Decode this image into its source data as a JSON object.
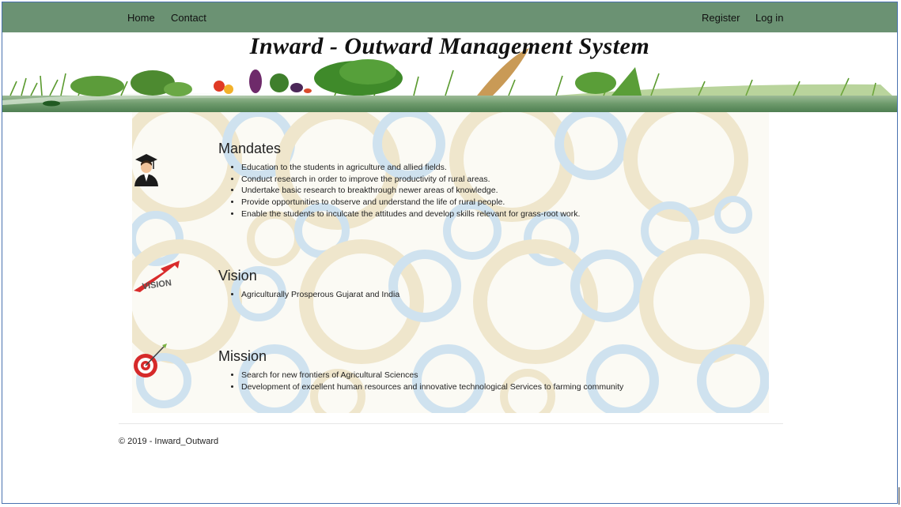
{
  "nav": {
    "home": "Home",
    "contact": "Contact",
    "register": "Register",
    "login": "Log in"
  },
  "banner": {
    "title": "Inward - Outward Management System"
  },
  "mandates": {
    "title": "Mandates",
    "icon": "graduate-icon",
    "items": [
      "Education to the students in agriculture and allied fields.",
      "Conduct research in order to improve the productivity of rural areas.",
      "Undertake basic research to breakthrough newer areas of knowledge.",
      "Provide opportunities to observe and understand the life of rural people.",
      "Enable the students to inculcate the attitudes and develop skills relevant for grass-root work."
    ]
  },
  "vision": {
    "title": "Vision",
    "icon": "vision-arrow-icon",
    "icon_text": "VISION",
    "items": [
      "Agriculturally Prosperous Gujarat and India"
    ]
  },
  "mission": {
    "title": "Mission",
    "icon": "target-icon",
    "items": [
      "Search for new frontiers of Agricultural Sciences",
      "Development of excellent human resources and innovative technological Services to farming community"
    ]
  },
  "footer": {
    "text": "© 2019 - Inward_Outward"
  },
  "colors": {
    "navbar": "#6b9273",
    "banner_band": "#6d9a6b",
    "pattern_blue": "#cfe2ef",
    "pattern_beige": "#efe6cc"
  }
}
